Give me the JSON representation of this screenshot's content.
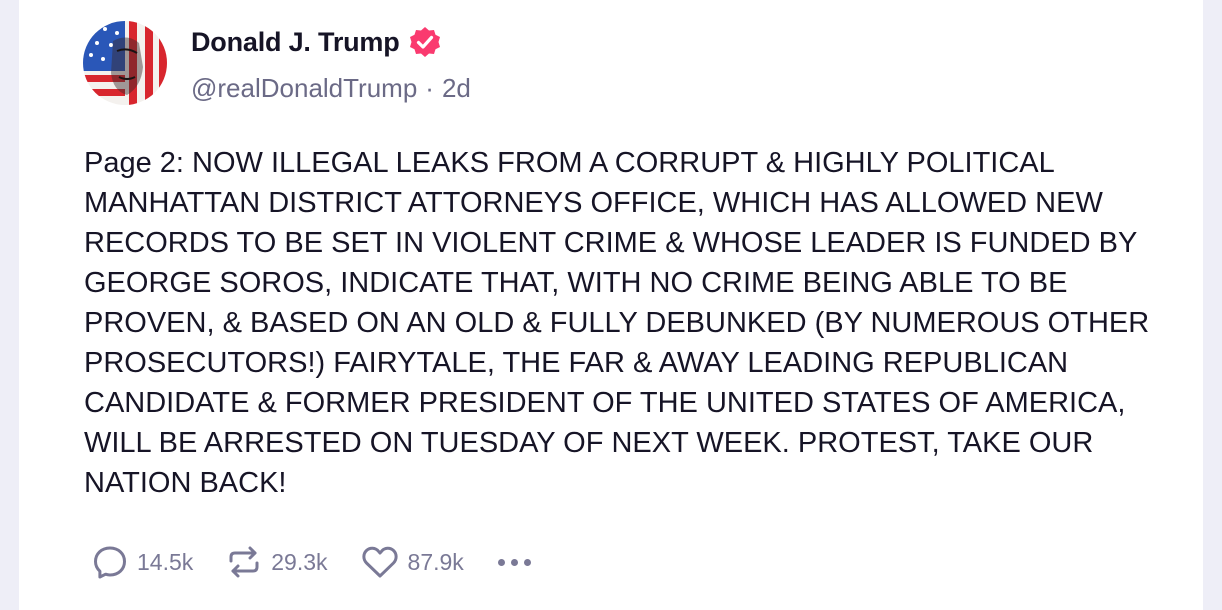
{
  "post": {
    "author": {
      "display_name": "Donald J. Trump",
      "handle": "@realDonaldTrump",
      "separator": "·",
      "time_ago": "2d",
      "verified_icon": "verified-badge-icon",
      "avatar_icon": "profile-avatar"
    },
    "text": "Page 2: NOW ILLEGAL LEAKS FROM A CORRUPT & HIGHLY POLITICAL MANHATTAN DISTRICT ATTORNEYS OFFICE, WHICH HAS ALLOWED NEW RECORDS TO BE SET IN VIOLENT CRIME & WHOSE LEADER IS FUNDED BY GEORGE SOROS, INDICATE THAT, WITH NO CRIME BEING ABLE TO BE PROVEN, & BASED ON AN OLD & FULLY DEBUNKED (BY NUMEROUS OTHER PROSECUTORS!) FAIRYTALE, THE FAR & AWAY LEADING REPUBLICAN CANDIDATE & FORMER PRESIDENT OF THE UNITED STATES OF AMERICA, WILL BE ARRESTED ON TUESDAY OF NEXT WEEK. PROTEST, TAKE OUR NATION BACK!",
    "actions": {
      "replies": {
        "icon": "reply-icon",
        "count": "14.5k"
      },
      "retruths": {
        "icon": "repost-icon",
        "count": "29.3k"
      },
      "likes": {
        "icon": "heart-icon",
        "count": "87.9k"
      },
      "more": {
        "icon": "more-dots-icon"
      }
    }
  },
  "colors": {
    "background": "#eeeef7",
    "card": "#ffffff",
    "text_primary": "#161426",
    "text_secondary": "#6b6a86",
    "action_gray": "#7a7996",
    "verified_badge": "#fa3a6f"
  }
}
